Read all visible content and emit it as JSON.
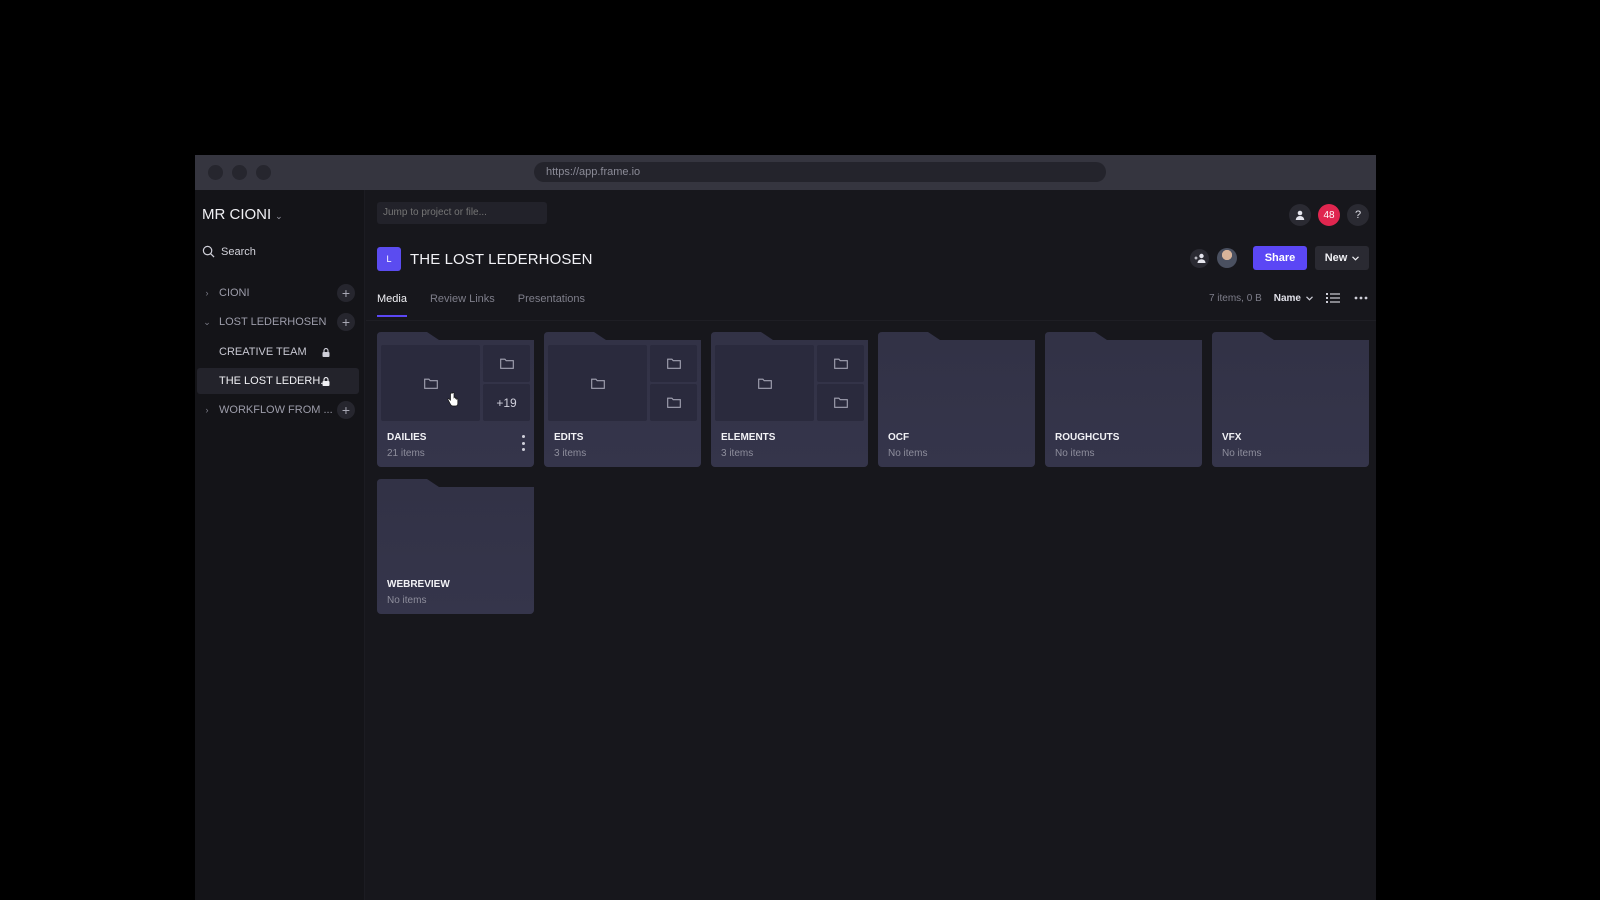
{
  "browser": {
    "url": "https://app.frame.io"
  },
  "sidebar": {
    "workspace": "MR CIONI",
    "search_label": "Search",
    "teams": [
      {
        "label": "CIONI",
        "expanded": false
      },
      {
        "label": "LOST LEDERHOSEN",
        "expanded": true,
        "projects": [
          {
            "label": "CREATIVE TEAM",
            "locked": true,
            "active": false
          },
          {
            "label": "THE LOST LEDERH...",
            "locked": true,
            "active": true
          }
        ]
      },
      {
        "label": "WORKFLOW FROM ...",
        "expanded": false
      }
    ]
  },
  "header": {
    "jump_placeholder": "Jump to project or file...",
    "notifications_count": "48",
    "help_label": "?"
  },
  "project": {
    "logo_letter": "L",
    "title": "THE LOST LEDERHOSEN",
    "share_label": "Share",
    "new_label": "New",
    "tabs": [
      {
        "label": "Media",
        "active": true
      },
      {
        "label": "Review Links",
        "active": false
      },
      {
        "label": "Presentations",
        "active": false
      }
    ],
    "summary": "7 items, 0 B",
    "sort_label": "Name"
  },
  "folders": [
    {
      "name": "DAILIES",
      "count": "21 items",
      "extra": "+19"
    },
    {
      "name": "EDITS",
      "count": "3 items"
    },
    {
      "name": "ELEMENTS",
      "count": "3 items"
    },
    {
      "name": "OCF",
      "count": "No items"
    },
    {
      "name": "ROUGHCUTS",
      "count": "No items"
    },
    {
      "name": "VFX",
      "count": "No items"
    },
    {
      "name": "WEBREVIEW",
      "count": "No items"
    }
  ],
  "colors": {
    "accent": "#5b47f5",
    "badge": "#e0264f",
    "folder": "#33334a",
    "background": "#17171c"
  }
}
